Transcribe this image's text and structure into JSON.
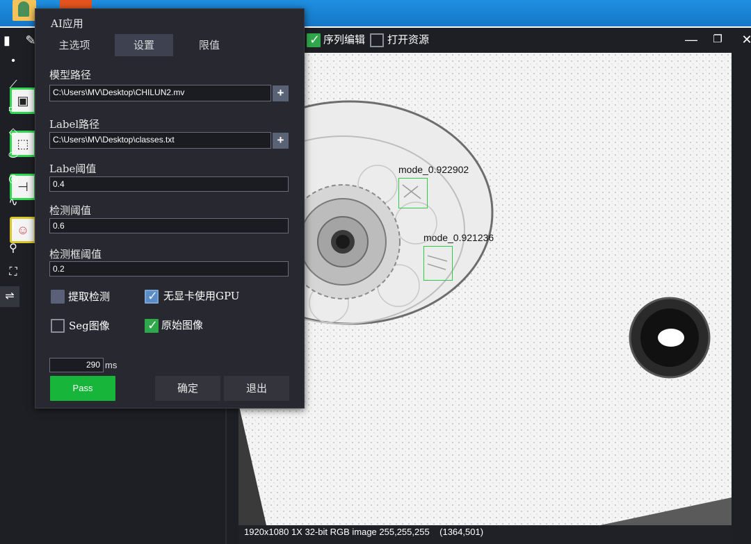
{
  "toolbar": {
    "sequence_edit_label": "序列编辑",
    "open_resource_label": "打开资源",
    "sequence_edit_checked": true,
    "open_resource_checked": false
  },
  "dialog": {
    "title": "AI应用",
    "tabs": [
      {
        "label": "主选项",
        "active": false
      },
      {
        "label": "设置",
        "active": true
      },
      {
        "label": "限值",
        "active": false
      }
    ],
    "model_path": {
      "label": "模型路径",
      "value": "C:\\Users\\MV\\Desktop\\CHILUN2.mv"
    },
    "label_path": {
      "label": "Label路径",
      "value": "C:\\Users\\MV\\Desktop\\classes.txt"
    },
    "label_threshold": {
      "label": "Labe阈值",
      "value": "0.4"
    },
    "detect_threshold": {
      "label": "检测阈值",
      "value": "0.6"
    },
    "box_threshold": {
      "label": "检测框阈值",
      "value": "0.2"
    },
    "options": {
      "extract_detect": {
        "label": "提取检测",
        "checked": false
      },
      "no_gpu": {
        "label": "无显卡使用GPU",
        "checked": true
      },
      "seg_image": {
        "label": "Seg图像",
        "checked": false
      },
      "original_image": {
        "label": "原始图像",
        "checked": true
      }
    },
    "timing": {
      "value": "290",
      "unit": "ms"
    },
    "pass_label": "Pass",
    "ok_label": "确定",
    "exit_label": "退出"
  },
  "image": {
    "detections": [
      {
        "label": "mode_0.922902"
      },
      {
        "label": "mode_0.921236"
      }
    ],
    "status": "1920x1080 1X 32-bit RGB image 255,255,255    (1364,501)"
  },
  "colors": {
    "accent_green": "#17b53a",
    "detect_box": "#2ecc40",
    "panel_bg": "#272830",
    "desktop_blue": "#1f8fe0"
  },
  "icons": {
    "left_dock": [
      "image-measure-icon",
      "image-select-icon",
      "align-icon",
      "ai-brain-icon"
    ],
    "right_tools": [
      "point-icon",
      "line-icon",
      "rectangle-icon",
      "rotated-rect-icon",
      "ellipse-icon",
      "ring-icon",
      "polyline-icon",
      "curve-icon",
      "zoom-icon",
      "fit-icon",
      "swap-icon"
    ]
  }
}
